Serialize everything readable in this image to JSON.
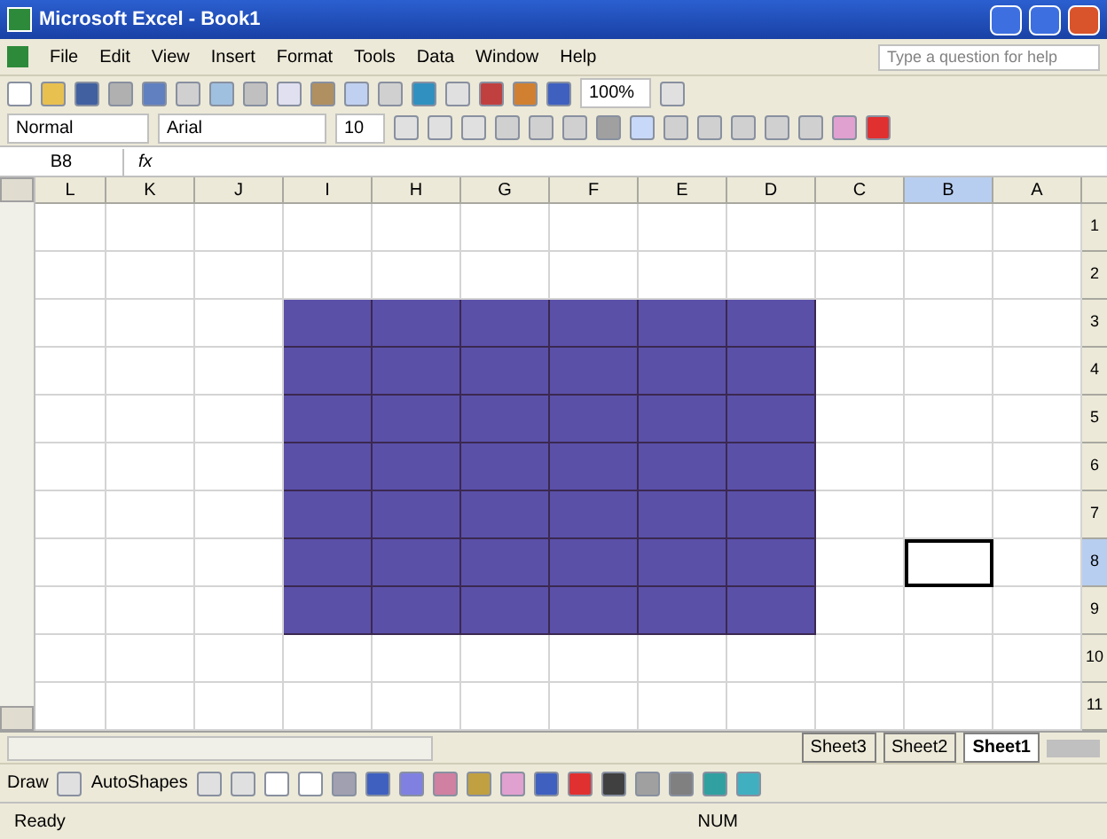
{
  "window": {
    "title": "Microsoft Excel - Book1"
  },
  "menu": [
    "File",
    "Edit",
    "View",
    "Insert",
    "Format",
    "Tools",
    "Data",
    "Window",
    "Help"
  ],
  "help_search": {
    "placeholder": "Type a question for help"
  },
  "standard_toolbar": {
    "zoom": "100%"
  },
  "formatting_toolbar": {
    "style": "Normal",
    "font": "Arial",
    "size": "10"
  },
  "formula_bar": {
    "name_box": "B8",
    "fx": "fx"
  },
  "columns": [
    {
      "label": "L",
      "selected": false
    },
    {
      "label": "K",
      "selected": false
    },
    {
      "label": "J",
      "selected": false
    },
    {
      "label": "I",
      "selected": false
    },
    {
      "label": "H",
      "selected": false
    },
    {
      "label": "G",
      "selected": false
    },
    {
      "label": "F",
      "selected": false
    },
    {
      "label": "E",
      "selected": false
    },
    {
      "label": "D",
      "selected": false
    },
    {
      "label": "C",
      "selected": false
    },
    {
      "label": "B",
      "selected": true
    },
    {
      "label": "A",
      "selected": false
    }
  ],
  "rows": [
    {
      "label": "1",
      "selected": false,
      "cells": [
        {
          "kind": "empty"
        },
        {
          "kind": "empty"
        },
        {
          "kind": "empty"
        },
        {
          "kind": "empty"
        },
        {
          "kind": "empty"
        },
        {
          "kind": "empty"
        },
        {
          "kind": "empty"
        },
        {
          "kind": "empty"
        },
        {
          "kind": "empty"
        },
        {
          "kind": "empty"
        },
        {
          "kind": "empty"
        },
        {
          "kind": "empty"
        }
      ]
    },
    {
      "label": "2",
      "selected": false,
      "cells": [
        {
          "kind": "empty"
        },
        {
          "kind": "empty"
        },
        {
          "kind": "empty"
        },
        {
          "kind": "empty"
        },
        {
          "kind": "empty"
        },
        {
          "kind": "empty"
        },
        {
          "kind": "empty"
        },
        {
          "kind": "empty"
        },
        {
          "kind": "empty"
        },
        {
          "kind": "empty"
        },
        {
          "kind": "empty"
        },
        {
          "kind": "empty"
        }
      ]
    },
    {
      "label": "3",
      "selected": false,
      "cells": [
        {
          "kind": "empty"
        },
        {
          "kind": "empty"
        },
        {
          "kind": "empty"
        },
        {
          "kind": "filled"
        },
        {
          "kind": "filled"
        },
        {
          "kind": "filled"
        },
        {
          "kind": "filled"
        },
        {
          "kind": "filled"
        },
        {
          "kind": "filled"
        },
        {
          "kind": "empty"
        },
        {
          "kind": "empty"
        },
        {
          "kind": "empty"
        }
      ]
    },
    {
      "label": "4",
      "selected": false,
      "cells": [
        {
          "kind": "empty"
        },
        {
          "kind": "empty"
        },
        {
          "kind": "empty"
        },
        {
          "kind": "filled"
        },
        {
          "kind": "filled"
        },
        {
          "kind": "filled"
        },
        {
          "kind": "filled"
        },
        {
          "kind": "filled"
        },
        {
          "kind": "filled"
        },
        {
          "kind": "empty"
        },
        {
          "kind": "empty"
        },
        {
          "kind": "empty"
        }
      ]
    },
    {
      "label": "5",
      "selected": false,
      "cells": [
        {
          "kind": "empty"
        },
        {
          "kind": "empty"
        },
        {
          "kind": "empty"
        },
        {
          "kind": "filled"
        },
        {
          "kind": "filled"
        },
        {
          "kind": "filled"
        },
        {
          "kind": "filled"
        },
        {
          "kind": "filled"
        },
        {
          "kind": "filled"
        },
        {
          "kind": "empty"
        },
        {
          "kind": "empty"
        },
        {
          "kind": "empty"
        }
      ]
    },
    {
      "label": "6",
      "selected": false,
      "cells": [
        {
          "kind": "empty"
        },
        {
          "kind": "empty"
        },
        {
          "kind": "empty"
        },
        {
          "kind": "filled"
        },
        {
          "kind": "filled"
        },
        {
          "kind": "filled"
        },
        {
          "kind": "filled"
        },
        {
          "kind": "filled"
        },
        {
          "kind": "filled"
        },
        {
          "kind": "empty"
        },
        {
          "kind": "empty"
        },
        {
          "kind": "empty"
        }
      ]
    },
    {
      "label": "7",
      "selected": false,
      "cells": [
        {
          "kind": "empty"
        },
        {
          "kind": "empty"
        },
        {
          "kind": "empty"
        },
        {
          "kind": "filled"
        },
        {
          "kind": "filled"
        },
        {
          "kind": "filled"
        },
        {
          "kind": "filled"
        },
        {
          "kind": "filled"
        },
        {
          "kind": "filled"
        },
        {
          "kind": "empty"
        },
        {
          "kind": "empty"
        },
        {
          "kind": "empty"
        }
      ]
    },
    {
      "label": "8",
      "selected": true,
      "cells": [
        {
          "kind": "empty"
        },
        {
          "kind": "empty"
        },
        {
          "kind": "empty"
        },
        {
          "kind": "filled"
        },
        {
          "kind": "filled"
        },
        {
          "kind": "filled"
        },
        {
          "kind": "filled"
        },
        {
          "kind": "filled"
        },
        {
          "kind": "filled"
        },
        {
          "kind": "empty"
        },
        {
          "kind": "active"
        },
        {
          "kind": "empty"
        }
      ]
    },
    {
      "label": "9",
      "selected": false,
      "cells": [
        {
          "kind": "empty"
        },
        {
          "kind": "empty"
        },
        {
          "kind": "empty"
        },
        {
          "kind": "filled"
        },
        {
          "kind": "filled"
        },
        {
          "kind": "filled"
        },
        {
          "kind": "filled"
        },
        {
          "kind": "filled"
        },
        {
          "kind": "filled"
        },
        {
          "kind": "empty"
        },
        {
          "kind": "empty"
        },
        {
          "kind": "empty"
        }
      ]
    },
    {
      "label": "10",
      "selected": false,
      "cells": [
        {
          "kind": "empty"
        },
        {
          "kind": "empty"
        },
        {
          "kind": "empty"
        },
        {
          "kind": "empty"
        },
        {
          "kind": "empty"
        },
        {
          "kind": "empty"
        },
        {
          "kind": "empty"
        },
        {
          "kind": "empty"
        },
        {
          "kind": "empty"
        },
        {
          "kind": "empty"
        },
        {
          "kind": "empty"
        },
        {
          "kind": "empty"
        }
      ]
    },
    {
      "label": "11",
      "selected": false,
      "cells": [
        {
          "kind": "empty"
        },
        {
          "kind": "empty"
        },
        {
          "kind": "empty"
        },
        {
          "kind": "empty"
        },
        {
          "kind": "empty"
        },
        {
          "kind": "empty"
        },
        {
          "kind": "empty"
        },
        {
          "kind": "empty"
        },
        {
          "kind": "empty"
        },
        {
          "kind": "empty"
        },
        {
          "kind": "empty"
        },
        {
          "kind": "empty"
        }
      ]
    }
  ],
  "sheet_tabs": [
    {
      "label": "Sheet3",
      "selected": false
    },
    {
      "label": "Sheet2",
      "selected": false
    },
    {
      "label": "Sheet1",
      "selected": true
    }
  ],
  "drawing_toolbar": {
    "draw": "Draw",
    "autoshapes": "AutoShapes"
  },
  "status_bar": {
    "left": "Ready",
    "right": "NUM"
  }
}
